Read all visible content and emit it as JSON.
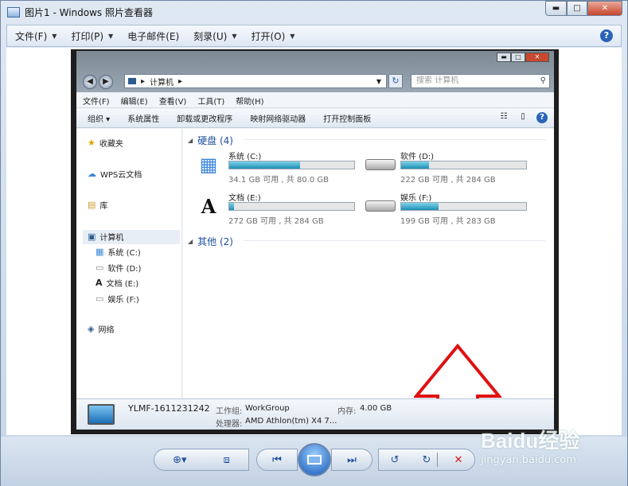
{
  "window": {
    "title": "图片1 - Windows 照片查看器",
    "min": "▬",
    "max": "□",
    "close": "✕"
  },
  "menu": {
    "items": [
      {
        "label": "文件(F)",
        "dropdown": true
      },
      {
        "label": "打印(P)",
        "dropdown": true
      },
      {
        "label": "电子邮件(E)",
        "dropdown": false
      },
      {
        "label": "刻录(U)",
        "dropdown": true
      },
      {
        "label": "打开(O)",
        "dropdown": true
      }
    ],
    "help": "?"
  },
  "explorer": {
    "address": {
      "arrow": "▸",
      "path": "计算机",
      "after": "▸"
    },
    "search_placeholder": "搜索 计算机",
    "menu": [
      "文件(F)",
      "编辑(E)",
      "查看(V)",
      "工具(T)",
      "帮助(H)"
    ],
    "toolbar": [
      "组织 ▾",
      "系统属性",
      "卸载或更改程序",
      "映射网络驱动器",
      "打开控制面板"
    ],
    "nav": {
      "favorites": "收藏夹",
      "wps": "WPS云文档",
      "library": "库",
      "computer": "计算机",
      "drives": [
        "系统 (C:)",
        "软件 (D:)",
        "文档 (E:)",
        "娱乐 (F:)"
      ],
      "network": "网络"
    },
    "groups": {
      "hdd": "硬盘 (4)",
      "other": "其他 (2)"
    },
    "drives": [
      {
        "name": "系统 (C:)",
        "info": "34.1 GB 可用 , 共 80.0 GB",
        "used_fraction": 0.57
      },
      {
        "name": "软件 (D:)",
        "info": "222 GB 可用 , 共 284 GB",
        "used_fraction": 0.22
      },
      {
        "name": "文档 (E:)",
        "info": "272 GB 可用 , 共 284 GB",
        "used_fraction": 0.04
      },
      {
        "name": "娱乐 (F:)",
        "info": "199 GB 可用 , 共 283 GB",
        "used_fraction": 0.3
      }
    ],
    "status": {
      "computer_name": "YLMF-1611231242",
      "workgroup_label": "工作组:",
      "workgroup": "WorkGroup",
      "memory_label": "内存:",
      "memory": "4.00 GB",
      "cpu_label": "处理器:",
      "cpu": "AMD Athlon(tm) X4 7..."
    }
  },
  "watermark": {
    "brand": "Baidu经验",
    "url": "jingyan.baidu.com"
  },
  "colors": {
    "accent": "#1e4f9c",
    "bar_fill": "#1c8fb5",
    "arrow": "#e01010"
  }
}
